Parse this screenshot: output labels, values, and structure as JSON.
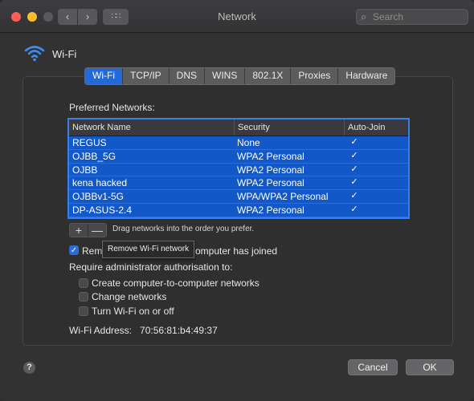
{
  "window": {
    "title": "Network",
    "search_placeholder": "Search"
  },
  "interface": {
    "name": "Wi-Fi"
  },
  "tabs": [
    {
      "label": "Wi-Fi",
      "active": true
    },
    {
      "label": "TCP/IP",
      "active": false
    },
    {
      "label": "DNS",
      "active": false
    },
    {
      "label": "WINS",
      "active": false
    },
    {
      "label": "802.1X",
      "active": false
    },
    {
      "label": "Proxies",
      "active": false
    },
    {
      "label": "Hardware",
      "active": false
    }
  ],
  "preferred_networks": {
    "label": "Preferred Networks:",
    "columns": [
      "Network Name",
      "Security",
      "Auto-Join"
    ],
    "rows": [
      {
        "name": "REGUS",
        "security": "None",
        "auto_join": true
      },
      {
        "name": "OJBB_5G",
        "security": "WPA2 Personal",
        "auto_join": true
      },
      {
        "name": "OJBB",
        "security": "WPA2 Personal",
        "auto_join": true
      },
      {
        "name": "kena hacked",
        "security": "WPA2 Personal",
        "auto_join": true
      },
      {
        "name": "OJBBv1-5G",
        "security": "WPA/WPA2 Personal",
        "auto_join": true
      },
      {
        "name": "DP-ASUS-2.4",
        "security": "WPA2 Personal",
        "auto_join": true
      }
    ],
    "add_symbol": "+",
    "remove_symbol": "—",
    "drag_hint": "Drag networks into the order you prefer."
  },
  "remember": {
    "label_start": "Rem",
    "label_end": "omputer has joined",
    "checked": true
  },
  "tooltip": "Remove Wi-Fi network",
  "admin": {
    "label": "Require administrator authorisation to:",
    "options": [
      {
        "label": "Create computer-to-computer networks",
        "checked": false
      },
      {
        "label": "Change networks",
        "checked": false
      },
      {
        "label": "Turn Wi-Fi on or off",
        "checked": false
      }
    ]
  },
  "wifi_address": "Wi-Fi Address:   70:56:81:b4:49:37",
  "buttons": {
    "help": "?",
    "cancel": "Cancel",
    "ok": "OK"
  },
  "colors": {
    "accent": "#2568d8",
    "selection": "#1358c9",
    "close": "#ff5f57",
    "minimize": "#febc2e"
  }
}
